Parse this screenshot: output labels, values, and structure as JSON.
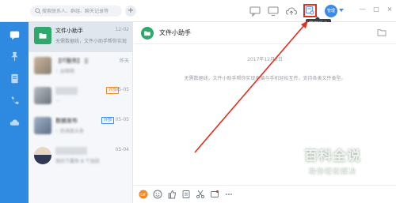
{
  "topbar": {
    "search_placeholder": "搜索联系人、群组、聊天记录等",
    "add_label": "+",
    "avatar_label": "管理",
    "admin_tooltip": "管理后台",
    "window_controls": [
      "—",
      "□",
      "×"
    ]
  },
  "rail": {
    "items": [
      "message-icon",
      "pin-icon",
      "book-icon",
      "phone-icon",
      "cloud-icon"
    ]
  },
  "conversations": [
    {
      "title": "文件小助手",
      "time": "12-02",
      "preview": "无需数据线，文件小助手帮你实现",
      "active": true
    },
    {
      "title": "【IT服务】 ||",
      "time": "昨天",
      "preview": "：@晓晓 ",
      "tag": "",
      "blurred": true
    },
    {
      "title": "",
      "time": "05-05",
      "preview": "…",
      "tag": "外部",
      "blurred": true
    },
    {
      "title": "数据发布",
      "time": "05-05",
      "preview": "：的消息头条",
      "tag": "外部",
      "blurred": true
    },
    {
      "title": "",
      "time": "05-04",
      "preview": "我的下属有 8 个加班",
      "blurred": true
    }
  ],
  "chat": {
    "title": "文件小助手",
    "date": "2017年12月2日",
    "system_message": "无需数据线，文件小助手帮你实现电脑与手机轻松互传，支持各类文件类型。"
  },
  "compose": {
    "icons": [
      "emoji-gif-icon",
      "emoji-icon",
      "like-icon",
      "attach-icon",
      "scissors-icon",
      "screenshot-icon",
      "more-icon"
    ]
  },
  "watermark": {
    "title": "百科全说",
    "subtitle": "助你轻松解决"
  },
  "colors": {
    "rail": "#2e89e0",
    "highlight": "#e0301e",
    "file_helper": "#2ea86b"
  }
}
